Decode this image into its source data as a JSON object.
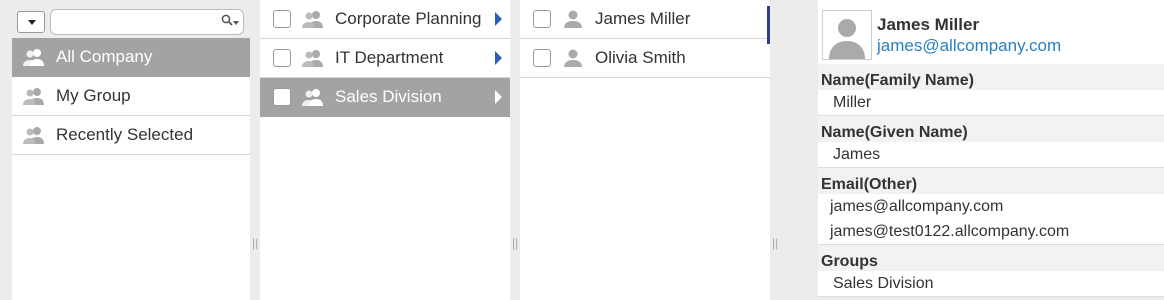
{
  "sidebar": {
    "items": [
      {
        "label": "All Company",
        "selected": true
      },
      {
        "label": "My Group",
        "selected": false
      },
      {
        "label": "Recently Selected",
        "selected": false
      }
    ]
  },
  "groups": {
    "items": [
      {
        "label": "Corporate Planning",
        "selected": false
      },
      {
        "label": "IT Department",
        "selected": false
      },
      {
        "label": "Sales Division",
        "selected": true
      }
    ]
  },
  "users": {
    "items": [
      {
        "label": "James Miller"
      },
      {
        "label": "Olivia Smith"
      }
    ]
  },
  "profile": {
    "name": "James Miller",
    "email": "james@allcompany.com",
    "family_name_label": "Name(Family Name)",
    "family_name": "Miller",
    "given_name_label": "Name(Given Name)",
    "given_name": "James",
    "email_other_label": "Email(Other)",
    "email_other": [
      "james@allcompany.com",
      "james@test0122.allcompany.com"
    ],
    "groups_label": "Groups",
    "groups": "Sales Division"
  },
  "splitter_glyph": "||",
  "colors": {
    "selected_bg": "#a3a3a3",
    "link": "#2a7fc4",
    "arrow": "#2a5fb8"
  }
}
